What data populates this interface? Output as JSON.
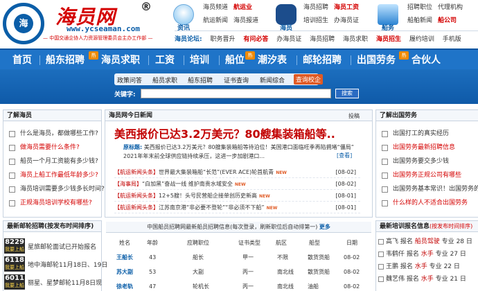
{
  "brand": {
    "name": "海员网",
    "reg": "®",
    "url": "www.ycseaman.com",
    "slogan": "— 中国交通企协人力资源管理委员会主办工作部 —",
    "badge": "海"
  },
  "header": {
    "col1": {
      "label": "资讯",
      "links": [
        [
          "海员频道",
          "航运业"
        ],
        [
          "航运新闻",
          "海员报道"
        ]
      ]
    },
    "col2": {
      "label": "海员",
      "links": [
        [
          "海员招聘",
          "海员工资"
        ],
        [
          "培训招生",
          "办海员证"
        ]
      ]
    },
    "col3": {
      "label": "船务",
      "links": [
        [
          "招聘职位",
          "代理机构"
        ],
        [
          "船舶新闻",
          "船公司"
        ]
      ]
    },
    "bar": {
      "title": "海员论坛:",
      "items": [
        "职务晋升",
        "有问必答",
        "办海员证",
        "海员招聘",
        "海员求职",
        "海员招生",
        "履约培训",
        "手机版"
      ]
    }
  },
  "nav": [
    "首页",
    "船东招聘",
    "海员求职",
    "工资",
    "培训",
    "船位",
    "潮汐表",
    "邮轮招聘",
    "出国劳务",
    "合伙人"
  ],
  "nav_hot": "热",
  "search": {
    "tabs": [
      "政策问答",
      "船员求职",
      "船东招聘",
      "证书查询",
      "新闻综合",
      "查询校企"
    ],
    "label": "关键字:",
    "button": "搜索"
  },
  "left": {
    "title": "了解海员",
    "items": [
      {
        "text": "什么是海员，都做哪些工作?",
        "c": ""
      },
      {
        "text": "做海员需要什么条件?",
        "c": "red"
      },
      {
        "text": "船员一个月工资能有多少钱?",
        "c": ""
      },
      {
        "text": "海员上船工作最低年龄多少?",
        "c": "red"
      },
      {
        "text": "海员培训需要多少钱多长时间?",
        "c": ""
      },
      {
        "text": "正规海员培训学校有哪些?",
        "c": "red"
      }
    ],
    "jobs_title": "最新邮轮招聘(按发布时间排序)",
    "jobs": [
      {
        "n": "8229",
        "s": "我要上船",
        "t": "星旅邮轮面试已开始报名"
      },
      {
        "n": "6118",
        "s": "我要上船",
        "t": "地中海邮轮11月18日、19日"
      },
      {
        "n": "6011",
        "s": "我要上船",
        "t": "丽星、星梦邮轮11月8日现"
      }
    ]
  },
  "center": {
    "title": "海员网今日新闻",
    "share": "投稿",
    "headline": "美西报价已达3.2万美元？80艘集装箱船等..",
    "source_label": "原标题:",
    "summary": "美西报价已达3.2万美元？80艘集装箱船等待泊位！美国港口面临旺季再陷拥堵“僵局” 2021年年末前全球供应链持续承压，这进一步加剧港口...",
    "more": "[查看]",
    "news": [
      {
        "tag": "【航运新闻头条】",
        "t": "世界最大集装箱船“长范”(EVER ACE)轮首航青",
        "d": "[08-02]",
        "new": "NEW"
      },
      {
        "tag": "【海事局】",
        "t": "“白加黑”奋战一线  维护南贵水域安全",
        "d": "[08-02]",
        "new": "NEW"
      },
      {
        "tag": "【航运新闻头条】",
        "t": "12+5艘！头号民营船企接单创历史新高",
        "d": "[08-01]",
        "new": "NEW"
      },
      {
        "tag": "【航运新闻头条】",
        "t": "江苏南京港“非必要不登轮”“非必须不下船”",
        "d": "[08-01]",
        "new": "NEW"
      }
    ],
    "jobs_header": "中国船员招聘网最新船员招聘信息(每次登录，刷新职位后自动排第一)",
    "jobs_more": "更多",
    "cols": [
      "姓名",
      "年龄",
      "应聘职位",
      "证书类型",
      "航区",
      "船型",
      "日期"
    ],
    "rows": [
      [
        "王船长",
        "43",
        "船长",
        "甲一",
        "不限",
        "散货货船",
        "08-02"
      ],
      [
        "苏大副",
        "53",
        "大副",
        "丙一",
        "南北线",
        "散货货船",
        "08-02"
      ],
      [
        "徐老轨",
        "47",
        "轮机长",
        "丙一",
        "南北线",
        "油船",
        "08-02"
      ]
    ]
  },
  "right": {
    "title": "了解出国劳务",
    "items": [
      {
        "text": "出国打工的真实经历",
        "c": ""
      },
      {
        "text": "出国劳务最新招聘信息",
        "c": "red"
      },
      {
        "text": "出国劳务要交多少钱",
        "c": ""
      },
      {
        "text": "出国劳务正规公司有哪些",
        "c": "red"
      },
      {
        "text": "出国劳务基本常识！出国劳务的",
        "c": ""
      },
      {
        "text": "什么样的人不适合出国劳务",
        "c": "red"
      }
    ],
    "train_title": "最新培训报名信息",
    "train_sub": "(按发布时间排序)",
    "train": [
      {
        "n": "高飞",
        "p": "船员驾驶",
        "d": "28"
      },
      {
        "n": "韦鹤仟",
        "p": "水手",
        "d": "27"
      },
      {
        "n": "王鹏",
        "p": "水手",
        "d": "22"
      },
      {
        "n": "魏艺伟",
        "p": "水手",
        "d": "21"
      }
    ],
    "train_words": {
      "sign": "报名",
      "major": "专业",
      "day": "日"
    }
  }
}
